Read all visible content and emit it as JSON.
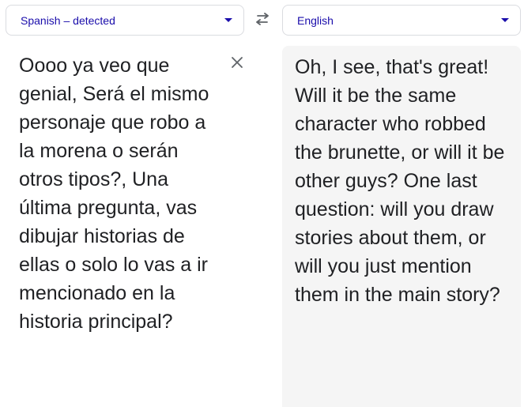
{
  "source_lang": {
    "label": "Spanish – detected"
  },
  "target_lang": {
    "label": "English"
  },
  "source_text": "Oooo ya veo que genial, Será el mismo personaje que robo a la morena o serán otros tipos?, Una última pregunta, vas dibujar historias de ellas o solo lo vas a ir mencionado en la historia principal?",
  "translated_text": "Oh, I see, that's great! Will it be the same character who robbed the brunette, or will it be other guys? One last question: will you draw stories about them, or will you just mention them in the main story?",
  "icons": {
    "swap": "swap-languages-icon",
    "clear": "close-icon",
    "dropdown": "chevron-down-icon"
  },
  "colors": {
    "accent": "#1a0dab",
    "text": "#202124",
    "icon": "#5f6368",
    "target_bg": "#f5f5f5",
    "border": "#dadce0"
  }
}
